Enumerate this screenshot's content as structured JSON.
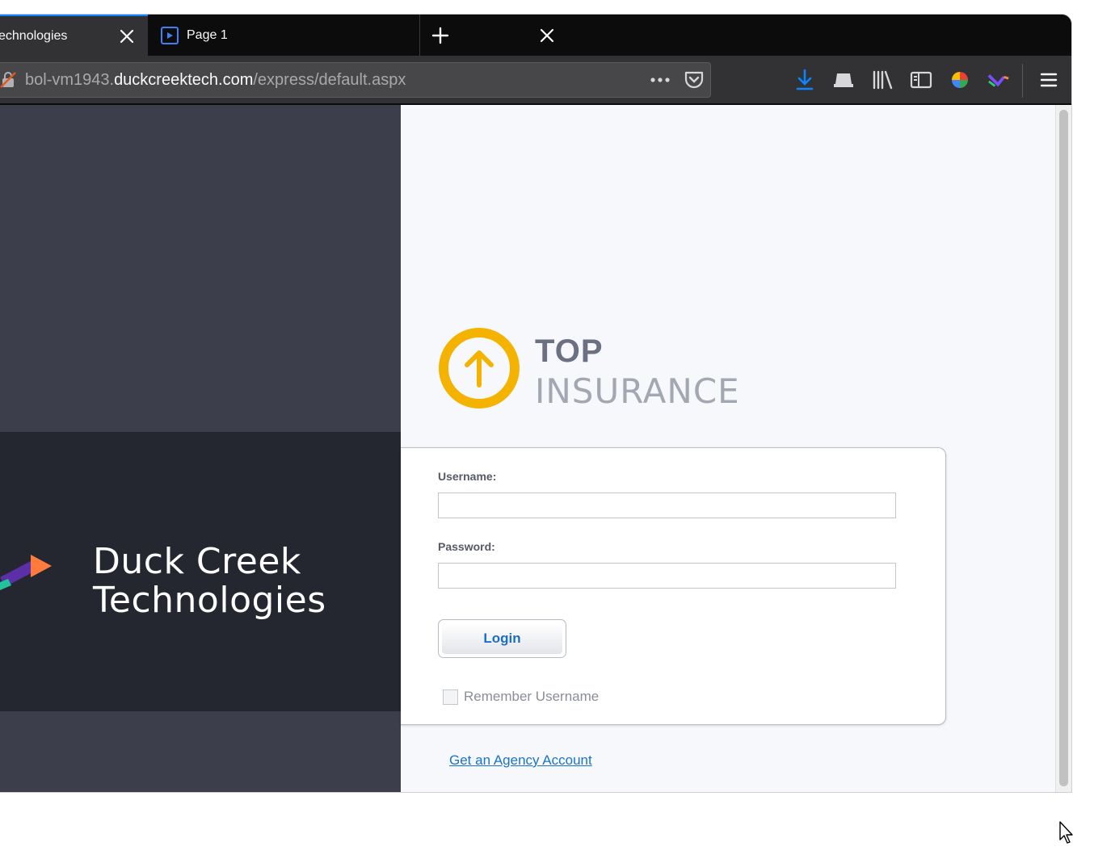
{
  "browser": {
    "tabs": [
      {
        "title": "echnologies",
        "active": true
      },
      {
        "title": "Page 1",
        "active": false
      }
    ],
    "url": {
      "prefix": "bol-vm1943.",
      "domain": "duckcreektech.com",
      "path": "/express/default.aspx"
    },
    "colors": {
      "accent": "#0a84ff",
      "download": "#0a84ff"
    }
  },
  "brand": {
    "line1": "Duck Creek",
    "line2": "Technologies"
  },
  "logo": {
    "top": "TOP",
    "bottom": "INSURANCE",
    "color": "#f5b301"
  },
  "login": {
    "username_label": "Username:",
    "username_value": "",
    "password_label": "Password:",
    "password_value": "",
    "button_label": "Login",
    "remember_label": "Remember Username",
    "remember_checked": false,
    "agency_link": "Get an Agency Account"
  }
}
